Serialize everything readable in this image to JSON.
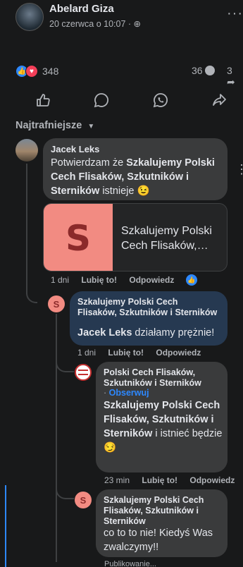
{
  "post": {
    "author": "Abelard Giza",
    "date": "20 czerwca o 10:07 ·",
    "reactions_count": "348",
    "comments_count": "36",
    "shares_count": "3"
  },
  "sort_label": "Najtrafniejsze",
  "comments": [
    {
      "author": "Jacek Leks",
      "text_prefix": "Potwierdzam że ",
      "mention": "Szkalujemy Polski Cech Flisaków, Szkutników i Sterników",
      "text_suffix": " istnieje 😉",
      "link_title": "Szkalujemy Polski Cech Flisaków,…",
      "time": "1 dni",
      "like": "Lubię to!",
      "reply": "Odpowiedz"
    },
    {
      "author": "Szkalujemy Polski Cech Flisaków, Szkutników i Sterników",
      "mention": "Jacek Leks",
      "text_suffix": " działamy prężnie!",
      "time": "1 dni",
      "like": "Lubię to!",
      "reply": "Odpowiedz"
    },
    {
      "author": "Polski Cech Flisaków, Szkutników i Sterników",
      "follow": "Obserwuj",
      "mention": "Szkalujemy Polski Cech Flisaków, Szkutników i Sterników",
      "text_suffix": " i istnieć będzie 😏",
      "time": "23 min",
      "like": "Lubię to!",
      "reply": "Odpowiedz"
    },
    {
      "author": "Szkalujemy Polski Cech Flisaków, Szkutników i Sterników",
      "text": "co to to nie! Kiedyś Was zwalczymy!!",
      "status": "Publikowanie..."
    }
  ],
  "colors": {
    "blue": "#2d88ff",
    "brand_s": "#f28b82",
    "brand_s_dark": "#8b2a2a"
  }
}
